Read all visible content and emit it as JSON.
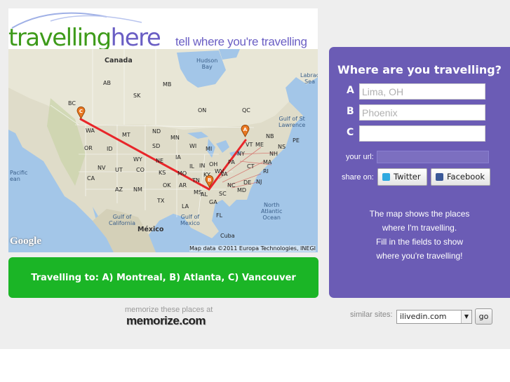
{
  "logo": {
    "part1": "travelling",
    "part2": "here",
    "tagline": "tell where you're travelling"
  },
  "map": {
    "labels": {
      "canada": "Canada",
      "hudson_bay": "Hudson\nBay",
      "labrador_sea": "Labrac\nSea",
      "ab": "AB",
      "sk": "SK",
      "mb": "MB",
      "bc": "BC",
      "on": "ON",
      "qc": "QC",
      "gulf_st_lawrence": "Gulf of St\nLawrence",
      "nb": "NB",
      "pe": "PE",
      "ns": "NS",
      "wa": "WA",
      "mt": "MT",
      "nd": "ND",
      "mn": "MN",
      "or": "OR",
      "id": "ID",
      "sd": "SD",
      "wi": "WI",
      "mi": "MI",
      "vt": "VT",
      "me": "ME",
      "nh": "NH",
      "ny": "NY",
      "ma": "MA",
      "wy": "WY",
      "ne": "NE",
      "ia": "IA",
      "ct": "CT",
      "ri": "RI",
      "pa": "PA",
      "nv": "NV",
      "ut": "UT",
      "co": "CO",
      "ks": "KS",
      "mo": "MO",
      "il": "IL",
      "in": "IN",
      "oh": "OH",
      "nj": "NJ",
      "ca": "CA",
      "az": "AZ",
      "nm": "NM",
      "ok": "OK",
      "ar": "AR",
      "tn": "TN",
      "va": "VA",
      "wv": "WV",
      "ky": "KY",
      "md": "MD",
      "de": "DE",
      "nc": "NC",
      "sc": "SC",
      "tx": "TX",
      "la": "LA",
      "ms": "MS",
      "al": "AL",
      "ga": "GA",
      "fl": "FL",
      "pacific_ocean": "Pacific\nean",
      "north_atlantic": "North\nAtlantic\nOcean",
      "gulf_california": "Gulf of\nCalifornia",
      "gulf_mexico": "Gulf of\nMexico",
      "mexico": "México",
      "cuba": "Cuba"
    },
    "google": "Google",
    "attribution": "Map data ©2011 Europa Technologies, INEGI",
    "markers": [
      "A",
      "B",
      "C"
    ]
  },
  "route_bar": {
    "text": "Travelling to: A) Montreal, B) Atlanta, C) Vancouver"
  },
  "memorize": {
    "label": "memorize these places at",
    "logo": "memorize.com"
  },
  "panel": {
    "title": "Where are you travelling?",
    "places": [
      {
        "label": "A",
        "placeholder": "Lima, OH",
        "value": ""
      },
      {
        "label": "B",
        "placeholder": "Phoenix",
        "value": ""
      },
      {
        "label": "C",
        "placeholder": "",
        "value": ""
      }
    ],
    "url_label": "your url:",
    "url_value": "",
    "share_label": "share on:",
    "twitter_label": "Twitter",
    "facebook_label": "Facebook",
    "info_lines": [
      "The map shows the places",
      "where I'm travelling.",
      "Fill in the fields to show",
      "where you're travelling!"
    ]
  },
  "similar": {
    "label": "similar sites:",
    "selected": "ilivedin.com",
    "go_label": "go"
  },
  "colors": {
    "brand_green": "#3e9b1a",
    "brand_purple": "#6b5cb5",
    "route_red": "#e8262a",
    "bar_green": "#1bb526"
  }
}
